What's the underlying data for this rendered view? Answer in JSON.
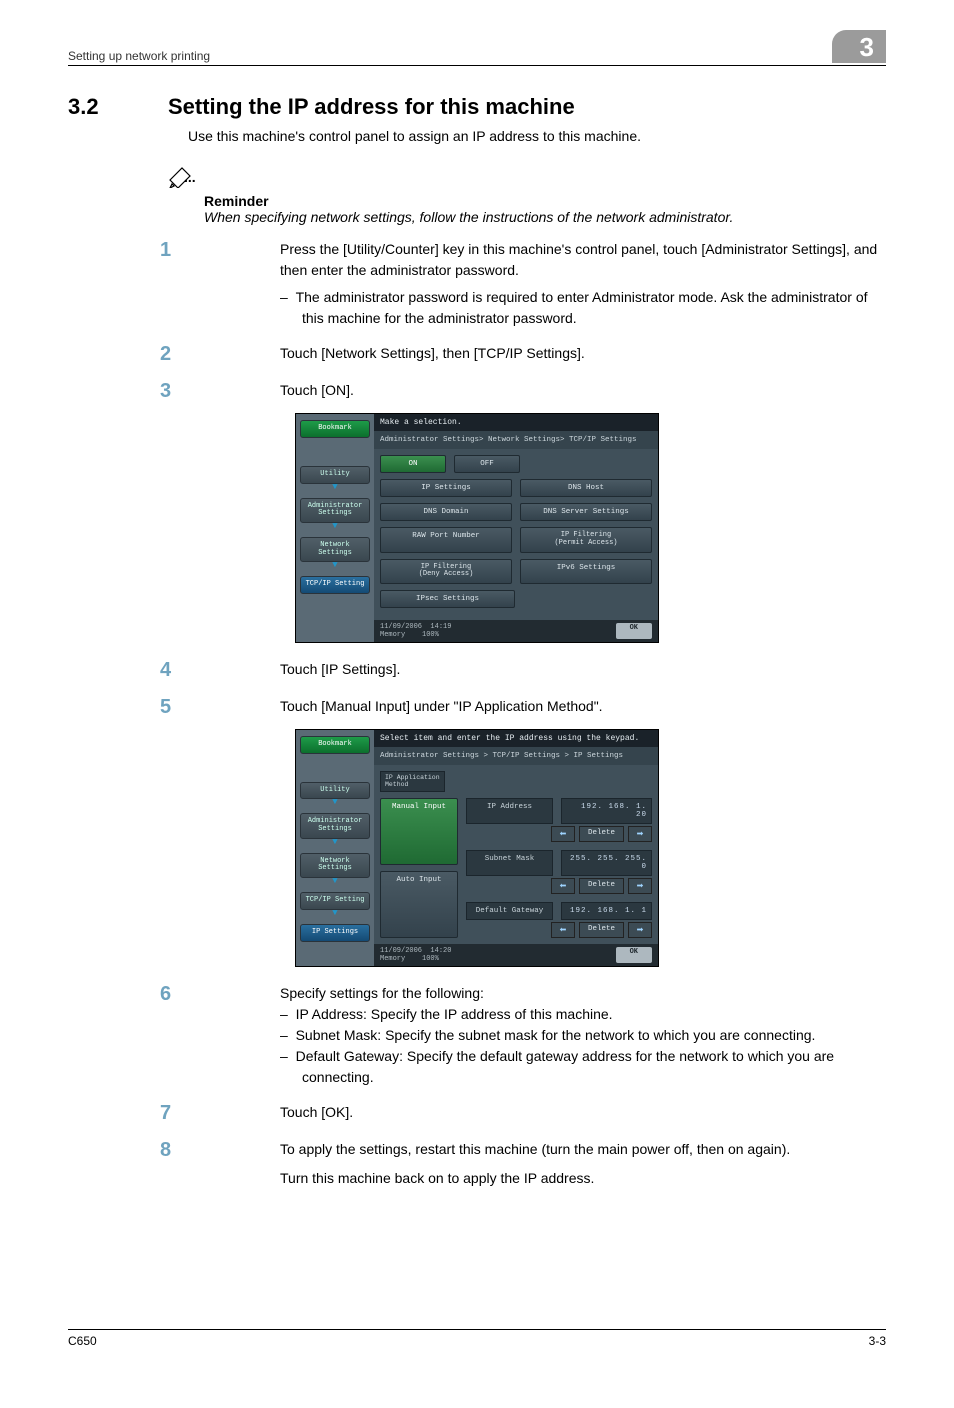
{
  "header": {
    "left": "Setting up network printing",
    "tab": "3"
  },
  "section": {
    "num": "3.2",
    "title": "Setting the IP address for this machine"
  },
  "intro": "Use this machine's control panel to assign an IP address to this machine.",
  "reminder": {
    "label": "Reminder",
    "text": "When specifying network settings, follow the instructions of the network administrator."
  },
  "steps": {
    "s1": "Press the [Utility/Counter] key in this machine's control panel, touch [Administrator Settings], and then enter the administrator password.",
    "s1a": "The administrator password is required to enter Administrator mode. Ask the administrator of this machine for the administrator password.",
    "s2": "Touch [Network Settings], then [TCP/IP Settings].",
    "s3": "Touch [ON].",
    "s4": "Touch [IP Settings].",
    "s5": "Touch [Manual Input] under \"IP Application Method\".",
    "s6": "Specify settings for the following:",
    "s6a": "IP Address: Specify the IP address of this machine.",
    "s6b": "Subnet Mask: Specify the subnet mask for the network to which you are connecting.",
    "s6c": "Default Gateway: Specify the default gateway address for the network to which you are connecting.",
    "s7": "Touch [OK].",
    "s8": "To apply the settings, restart this machine (turn the main power off, then on again).",
    "s8b": "Turn this machine back on to apply the IP address."
  },
  "shot1": {
    "sidebar": {
      "bookmark": "Bookmark",
      "utility": "Utility",
      "admin": "Administrator\nSettings",
      "network": "Network\nSettings",
      "tcpip": "TCP/IP Setting"
    },
    "title": "Make a selection.",
    "bread": "Administrator Settings> Network Settings> TCP/IP Settings",
    "on": "ON",
    "off": "OFF",
    "btns": {
      "ip": "IP Settings",
      "dnshost": "DNS Host",
      "dnsdom": "DNS Domain",
      "dnssrv": "DNS Server Settings",
      "raw": "RAW Port Number",
      "filtp": "IP Filtering\n(Permit Access)",
      "filtd": "IP Filtering\n(Deny Access)",
      "ipv6": "IPv6 Settings",
      "ipsec": "IPsec Settings"
    },
    "status": {
      "date": "11/09/2006",
      "time": "14:19",
      "mem": "Memory",
      "mempct": "100%",
      "ok": "OK"
    }
  },
  "shot2": {
    "sidebar": {
      "bookmark": "Bookmark",
      "utility": "Utility",
      "admin": "Administrator\nSettings",
      "network": "Network\nSettings",
      "tcpip": "TCP/IP Setting",
      "ipset": "IP Settings"
    },
    "title": "Select item and enter the IP address using the keypad.",
    "bread": "Administrator Settings > TCP/IP Settings > IP Settings",
    "method": "IP Application\nMethod",
    "manual": "Manual Input",
    "auto": "Auto Input",
    "ipaddr_l": "IP Address",
    "ipaddr_v": "192. 168.   1.  20",
    "subnet_l": "Subnet Mask",
    "subnet_v": "255. 255. 255.   0",
    "gw_l": "Default Gateway",
    "gw_v": "192. 168.   1.   1",
    "delete": "Delete",
    "status": {
      "date": "11/09/2006",
      "time": "14:20",
      "mem": "Memory",
      "mempct": "100%",
      "ok": "OK"
    }
  },
  "footer": {
    "left": "C650",
    "right": "3-3"
  }
}
